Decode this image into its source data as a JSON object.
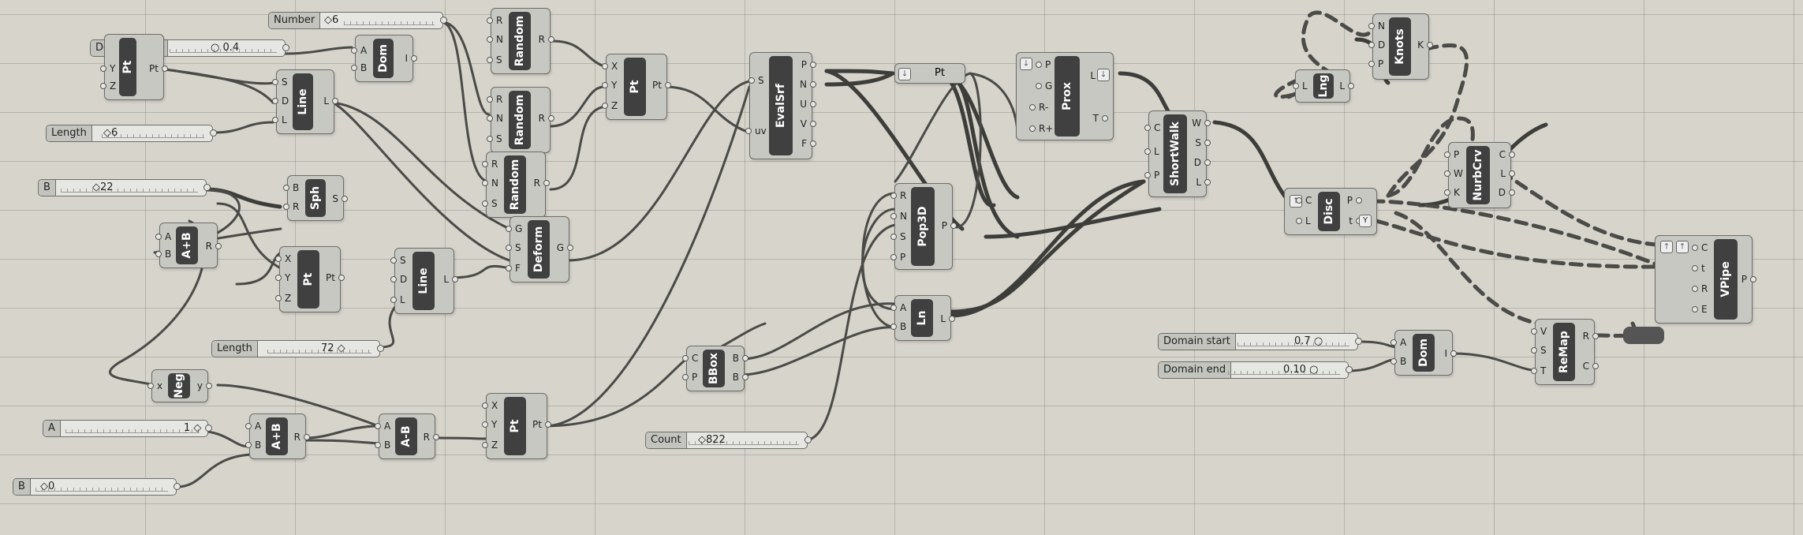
{
  "sliders": {
    "number": {
      "label": "Number",
      "value": "6"
    },
    "domain_start_1": {
      "label": "Domain start",
      "value": "0.4"
    },
    "length_1": {
      "label": "Length",
      "value": "6"
    },
    "b_1": {
      "label": "B",
      "value": "22"
    },
    "length_2": {
      "label": "Length",
      "value": "72"
    },
    "a_1": {
      "label": "A",
      "value": "1"
    },
    "b_2": {
      "label": "B",
      "value": "0"
    },
    "count": {
      "label": "Count",
      "value": "822"
    },
    "domain_start_2": {
      "label": "Domain start",
      "value": "0.7"
    },
    "domain_end": {
      "label": "Domain end",
      "value": "0.10"
    }
  },
  "components": {
    "pt1": {
      "name": "Pt",
      "inputs": [
        "Y",
        "Z"
      ],
      "outputs": [
        "Pt"
      ]
    },
    "dom1": {
      "name": "Dom",
      "inputs": [
        "A",
        "B"
      ],
      "outputs": [
        "I"
      ]
    },
    "line1": {
      "name": "Line",
      "inputs": [
        "S",
        "D",
        "L"
      ],
      "outputs": [
        "L"
      ]
    },
    "random1": {
      "name": "Random",
      "inputs": [
        "R",
        "N",
        "S"
      ],
      "outputs": [
        "R"
      ]
    },
    "random2": {
      "name": "Random",
      "inputs": [
        "R",
        "N",
        "S"
      ],
      "outputs": [
        "R"
      ]
    },
    "random3": {
      "name": "Random",
      "inputs": [
        "R",
        "N",
        "S"
      ],
      "outputs": [
        "R"
      ]
    },
    "pt2": {
      "name": "Pt",
      "inputs": [
        "X",
        "Y",
        "Z"
      ],
      "outputs": [
        "Pt"
      ]
    },
    "evalsrf": {
      "name": "EvalSrf",
      "inputs": [
        "S",
        "uv"
      ],
      "outputs": [
        "P",
        "N",
        "U",
        "V",
        "F"
      ]
    },
    "ptparam": {
      "name": "Pt"
    },
    "prox": {
      "name": "Prox",
      "inputs": [
        "P",
        "G",
        "R-",
        "R+"
      ],
      "outputs": [
        "L",
        "T"
      ]
    },
    "shortwalk": {
      "name": "ShortWalk",
      "inputs": [
        "C",
        "L",
        "P"
      ],
      "outputs": [
        "W",
        "S",
        "D",
        "L"
      ]
    },
    "lng": {
      "name": "Lng",
      "inputs": [
        "L"
      ],
      "outputs": [
        "L"
      ]
    },
    "knots": {
      "name": "Knots",
      "inputs": [
        "N",
        "D",
        "P"
      ],
      "outputs": [
        "K"
      ]
    },
    "nurbcrv": {
      "name": "NurbCrv",
      "inputs": [
        "P",
        "W",
        "K"
      ],
      "outputs": [
        "C",
        "L",
        "D"
      ]
    },
    "disc": {
      "name": "Disc",
      "inputs": [
        "C",
        "L"
      ],
      "outputs": [
        "P",
        "t"
      ]
    },
    "vpipe": {
      "name": "VPipe",
      "inputs": [
        "C",
        "t",
        "R",
        "E"
      ],
      "outputs": [
        "P"
      ]
    },
    "sph": {
      "name": "Sph",
      "inputs": [
        "B",
        "R"
      ],
      "outputs": [
        "S"
      ]
    },
    "aplusb1": {
      "name": "A+B",
      "inputs": [
        "A",
        "B"
      ],
      "outputs": [
        "R"
      ]
    },
    "pt3": {
      "name": "Pt",
      "inputs": [
        "X",
        "Y",
        "Z"
      ],
      "outputs": [
        "Pt"
      ]
    },
    "line2": {
      "name": "Line",
      "inputs": [
        "S",
        "D",
        "L"
      ],
      "outputs": [
        "L"
      ]
    },
    "deform": {
      "name": "Deform",
      "inputs": [
        "G",
        "S",
        "F"
      ],
      "outputs": [
        "G"
      ]
    },
    "pop3d": {
      "name": "Pop3D",
      "inputs": [
        "R",
        "N",
        "S",
        "P"
      ],
      "outputs": [
        "P"
      ]
    },
    "ln": {
      "name": "Ln",
      "inputs": [
        "A",
        "B"
      ],
      "outputs": [
        "L"
      ]
    },
    "bbox": {
      "name": "BBox",
      "inputs": [
        "C",
        "P"
      ],
      "outputs": [
        "B",
        "B"
      ]
    },
    "neg": {
      "name": "Neg",
      "inputs": [
        "x"
      ],
      "outputs": [
        "y"
      ]
    },
    "aplusb2": {
      "name": "A+B",
      "inputs": [
        "A",
        "B"
      ],
      "outputs": [
        "R"
      ]
    },
    "aminusb": {
      "name": "A-B",
      "inputs": [
        "A",
        "B"
      ],
      "outputs": [
        "R"
      ]
    },
    "pt4": {
      "name": "Pt",
      "inputs": [
        "X",
        "Y",
        "Z"
      ],
      "outputs": [
        "Pt"
      ]
    },
    "dom2": {
      "name": "Dom",
      "inputs": [
        "A",
        "B"
      ],
      "outputs": [
        "I"
      ]
    },
    "remap": {
      "name": "ReMap",
      "inputs": [
        "V",
        "S",
        "T"
      ],
      "outputs": [
        "R",
        "C"
      ]
    }
  },
  "icons": {
    "diamond": "◇",
    "circle": "○",
    "arrow_down": "🡓",
    "arrow_up": "🡑",
    "graft": "Y"
  }
}
